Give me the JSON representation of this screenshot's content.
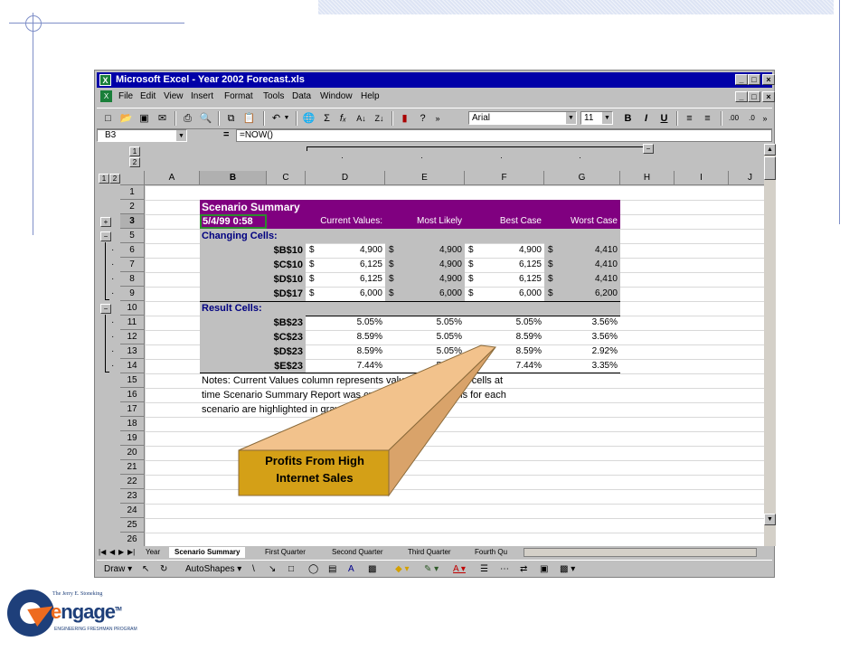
{
  "window": {
    "title": "Microsoft Excel - Year 2002 Forecast.xls",
    "caption_buttons": [
      "_",
      "□",
      "×"
    ],
    "doc_buttons": [
      "_",
      "□",
      "×"
    ]
  },
  "menu": [
    "File",
    "Edit",
    "View",
    "Insert",
    "Format",
    "Tools",
    "Data",
    "Window",
    "Help"
  ],
  "toolbar": {
    "font_name": "Arial",
    "font_size": "11",
    "bold": "B",
    "italic": "I",
    "underline": "U",
    "sum": "Σ",
    "fx": "fₓ"
  },
  "formula_bar": {
    "name_box": "B3",
    "equals": "=",
    "formula": "=NOW()"
  },
  "sheet": {
    "outline_levels_top": [
      "1",
      "2"
    ],
    "outline_levels_left": [
      "1",
      "2"
    ],
    "columns": [
      "A",
      "B",
      "C",
      "D",
      "E",
      "F",
      "G",
      "H",
      "I",
      "J"
    ],
    "rows": [
      "1",
      "2",
      "3",
      "5",
      "6",
      "7",
      "8",
      "9",
      "10",
      "11",
      "12",
      "13",
      "14",
      "15",
      "16",
      "17",
      "18",
      "19",
      "20",
      "21",
      "22",
      "23",
      "24",
      "25",
      "26"
    ],
    "selected_row": "3",
    "summary": {
      "title": "Scenario Summary",
      "timestamp": "5/4/99 0:58",
      "headers": [
        "Current Values:",
        "Most Likely",
        "Best Case",
        "Worst Case"
      ],
      "changing_label": "Changing Cells:",
      "changing_rows": [
        {
          "cell": "$B$10",
          "vals": [
            "4,900",
            "4,900",
            "4,900",
            "4,410"
          ]
        },
        {
          "cell": "$C$10",
          "vals": [
            "6,125",
            "4,900",
            "6,125",
            "4,410"
          ]
        },
        {
          "cell": "$D$10",
          "vals": [
            "6,125",
            "4,900",
            "6,125",
            "4,410"
          ]
        },
        {
          "cell": "$D$17",
          "vals": [
            "6,000",
            "6,000",
            "6,000",
            "6,200"
          ]
        }
      ],
      "currency": "$",
      "result_label": "Result Cells:",
      "result_rows": [
        {
          "cell": "$B$23",
          "vals": [
            "5.05%",
            "5.05%",
            "5.05%",
            "3.56%"
          ]
        },
        {
          "cell": "$C$23",
          "vals": [
            "8.59%",
            "5.05%",
            "8.59%",
            "3.56%"
          ]
        },
        {
          "cell": "$D$23",
          "vals": [
            "8.59%",
            "5.05%",
            "8.59%",
            "2.92%"
          ]
        },
        {
          "cell": "$E$23",
          "vals": [
            "7.44%",
            "5.05%",
            "7.44%",
            "3.35%"
          ]
        }
      ],
      "notes": [
        "Notes:  Current Values column represents values of changing cells at",
        "time Scenario Summary Report was created.  Changing cells for each",
        "scenario are highlighted in gray."
      ]
    }
  },
  "tabs": [
    "Year",
    "Scenario Summary",
    "First Quarter",
    "Second Quarter",
    "Third Quarter",
    "Fourth Qu"
  ],
  "drawbar": {
    "draw": "Draw",
    "autoshapes": "AutoShapes"
  },
  "callout": {
    "line1": "Profits From High",
    "line2": "Internet Sales"
  },
  "logo": {
    "small_text": "The Jerry E. Stoneking",
    "word": "engage",
    "tm": "TM",
    "tagline": "ENGINEERING FRESHMAN PROGRAM"
  }
}
